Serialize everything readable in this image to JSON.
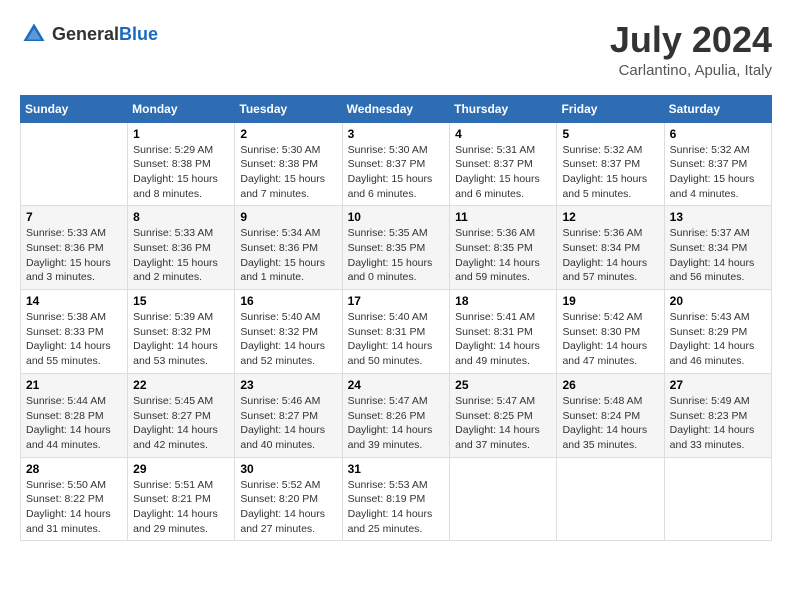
{
  "header": {
    "logo_general": "General",
    "logo_blue": "Blue",
    "month_year": "July 2024",
    "location": "Carlantino, Apulia, Italy"
  },
  "days_of_week": [
    "Sunday",
    "Monday",
    "Tuesday",
    "Wednesday",
    "Thursday",
    "Friday",
    "Saturday"
  ],
  "weeks": [
    [
      {
        "day": "",
        "info": ""
      },
      {
        "day": "1",
        "info": "Sunrise: 5:29 AM\nSunset: 8:38 PM\nDaylight: 15 hours\nand 8 minutes."
      },
      {
        "day": "2",
        "info": "Sunrise: 5:30 AM\nSunset: 8:38 PM\nDaylight: 15 hours\nand 7 minutes."
      },
      {
        "day": "3",
        "info": "Sunrise: 5:30 AM\nSunset: 8:37 PM\nDaylight: 15 hours\nand 6 minutes."
      },
      {
        "day": "4",
        "info": "Sunrise: 5:31 AM\nSunset: 8:37 PM\nDaylight: 15 hours\nand 6 minutes."
      },
      {
        "day": "5",
        "info": "Sunrise: 5:32 AM\nSunset: 8:37 PM\nDaylight: 15 hours\nand 5 minutes."
      },
      {
        "day": "6",
        "info": "Sunrise: 5:32 AM\nSunset: 8:37 PM\nDaylight: 15 hours\nand 4 minutes."
      }
    ],
    [
      {
        "day": "7",
        "info": "Sunrise: 5:33 AM\nSunset: 8:36 PM\nDaylight: 15 hours\nand 3 minutes."
      },
      {
        "day": "8",
        "info": "Sunrise: 5:33 AM\nSunset: 8:36 PM\nDaylight: 15 hours\nand 2 minutes."
      },
      {
        "day": "9",
        "info": "Sunrise: 5:34 AM\nSunset: 8:36 PM\nDaylight: 15 hours\nand 1 minute."
      },
      {
        "day": "10",
        "info": "Sunrise: 5:35 AM\nSunset: 8:35 PM\nDaylight: 15 hours\nand 0 minutes."
      },
      {
        "day": "11",
        "info": "Sunrise: 5:36 AM\nSunset: 8:35 PM\nDaylight: 14 hours\nand 59 minutes."
      },
      {
        "day": "12",
        "info": "Sunrise: 5:36 AM\nSunset: 8:34 PM\nDaylight: 14 hours\nand 57 minutes."
      },
      {
        "day": "13",
        "info": "Sunrise: 5:37 AM\nSunset: 8:34 PM\nDaylight: 14 hours\nand 56 minutes."
      }
    ],
    [
      {
        "day": "14",
        "info": "Sunrise: 5:38 AM\nSunset: 8:33 PM\nDaylight: 14 hours\nand 55 minutes."
      },
      {
        "day": "15",
        "info": "Sunrise: 5:39 AM\nSunset: 8:32 PM\nDaylight: 14 hours\nand 53 minutes."
      },
      {
        "day": "16",
        "info": "Sunrise: 5:40 AM\nSunset: 8:32 PM\nDaylight: 14 hours\nand 52 minutes."
      },
      {
        "day": "17",
        "info": "Sunrise: 5:40 AM\nSunset: 8:31 PM\nDaylight: 14 hours\nand 50 minutes."
      },
      {
        "day": "18",
        "info": "Sunrise: 5:41 AM\nSunset: 8:31 PM\nDaylight: 14 hours\nand 49 minutes."
      },
      {
        "day": "19",
        "info": "Sunrise: 5:42 AM\nSunset: 8:30 PM\nDaylight: 14 hours\nand 47 minutes."
      },
      {
        "day": "20",
        "info": "Sunrise: 5:43 AM\nSunset: 8:29 PM\nDaylight: 14 hours\nand 46 minutes."
      }
    ],
    [
      {
        "day": "21",
        "info": "Sunrise: 5:44 AM\nSunset: 8:28 PM\nDaylight: 14 hours\nand 44 minutes."
      },
      {
        "day": "22",
        "info": "Sunrise: 5:45 AM\nSunset: 8:27 PM\nDaylight: 14 hours\nand 42 minutes."
      },
      {
        "day": "23",
        "info": "Sunrise: 5:46 AM\nSunset: 8:27 PM\nDaylight: 14 hours\nand 40 minutes."
      },
      {
        "day": "24",
        "info": "Sunrise: 5:47 AM\nSunset: 8:26 PM\nDaylight: 14 hours\nand 39 minutes."
      },
      {
        "day": "25",
        "info": "Sunrise: 5:47 AM\nSunset: 8:25 PM\nDaylight: 14 hours\nand 37 minutes."
      },
      {
        "day": "26",
        "info": "Sunrise: 5:48 AM\nSunset: 8:24 PM\nDaylight: 14 hours\nand 35 minutes."
      },
      {
        "day": "27",
        "info": "Sunrise: 5:49 AM\nSunset: 8:23 PM\nDaylight: 14 hours\nand 33 minutes."
      }
    ],
    [
      {
        "day": "28",
        "info": "Sunrise: 5:50 AM\nSunset: 8:22 PM\nDaylight: 14 hours\nand 31 minutes."
      },
      {
        "day": "29",
        "info": "Sunrise: 5:51 AM\nSunset: 8:21 PM\nDaylight: 14 hours\nand 29 minutes."
      },
      {
        "day": "30",
        "info": "Sunrise: 5:52 AM\nSunset: 8:20 PM\nDaylight: 14 hours\nand 27 minutes."
      },
      {
        "day": "31",
        "info": "Sunrise: 5:53 AM\nSunset: 8:19 PM\nDaylight: 14 hours\nand 25 minutes."
      },
      {
        "day": "",
        "info": ""
      },
      {
        "day": "",
        "info": ""
      },
      {
        "day": "",
        "info": ""
      }
    ]
  ]
}
